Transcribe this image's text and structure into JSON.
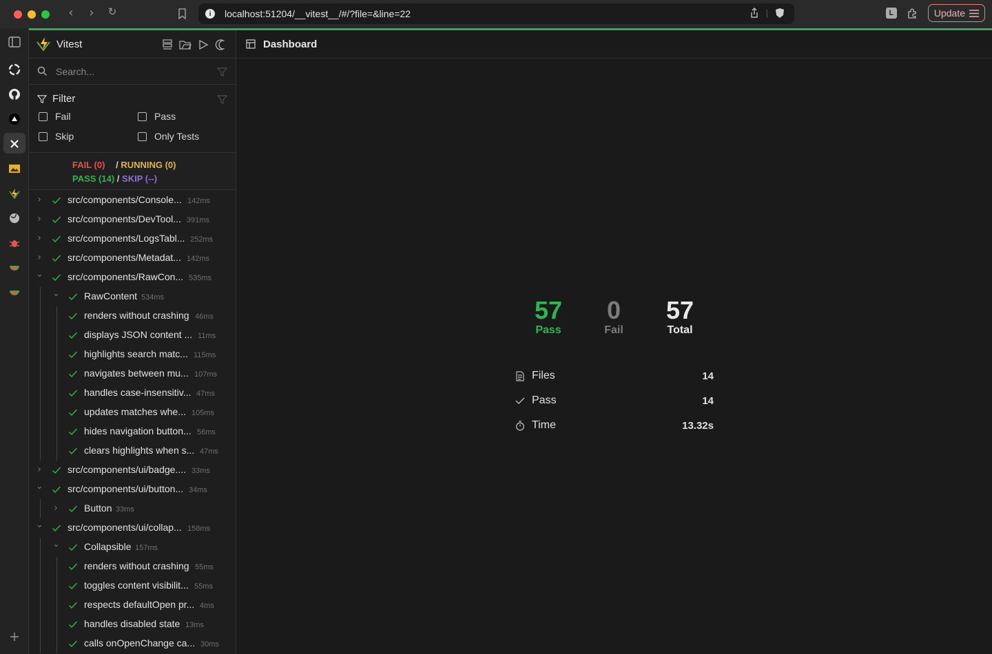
{
  "browser": {
    "url": "localhost:51204/__vitest__/#/?file=&line=22",
    "update_label": "Update",
    "ext_label": "L"
  },
  "sidebar": {
    "app_title": "Vitest",
    "search_placeholder": "Search...",
    "filter": {
      "title": "Filter",
      "options": [
        "Fail",
        "Pass",
        "Skip",
        "Only Tests"
      ]
    },
    "status": {
      "fail": "FAIL (0)",
      "sep1": "/",
      "running": "RUNNING (0)",
      "pass": "PASS (14)",
      "sep2": "/",
      "skip": "SKIP (--)"
    },
    "tree": [
      {
        "label": "src/components/Console...",
        "time": "142ms",
        "depth": 0,
        "chev": "right"
      },
      {
        "label": "src/components/DevTool...",
        "time": "391ms",
        "depth": 0,
        "chev": "right"
      },
      {
        "label": "src/components/LogsTabl...",
        "time": "252ms",
        "depth": 0,
        "chev": "right"
      },
      {
        "label": "src/components/Metadat...",
        "time": "142ms",
        "depth": 0,
        "chev": "right"
      },
      {
        "label": "src/components/RawCon...",
        "time": "535ms",
        "depth": 0,
        "chev": "down"
      },
      {
        "label": "RawContent",
        "time": "534ms",
        "depth": 1,
        "chev": "down"
      },
      {
        "label": "renders without crashing",
        "time": "46ms",
        "depth": 2,
        "chev": ""
      },
      {
        "label": "displays JSON content ...",
        "time": "11ms",
        "depth": 2,
        "chev": ""
      },
      {
        "label": "highlights search matc...",
        "time": "115ms",
        "depth": 2,
        "chev": ""
      },
      {
        "label": "navigates between mu...",
        "time": "107ms",
        "depth": 2,
        "chev": ""
      },
      {
        "label": "handles case-insensitiv...",
        "time": "47ms",
        "depth": 2,
        "chev": ""
      },
      {
        "label": "updates matches whe...",
        "time": "105ms",
        "depth": 2,
        "chev": ""
      },
      {
        "label": "hides navigation button...",
        "time": "56ms",
        "depth": 2,
        "chev": ""
      },
      {
        "label": "clears highlights when s...",
        "time": "47ms",
        "depth": 2,
        "chev": ""
      },
      {
        "label": "src/components/ui/badge....",
        "time": "33ms",
        "depth": 0,
        "chev": "right"
      },
      {
        "label": "src/components/ui/button...",
        "time": "34ms",
        "depth": 0,
        "chev": "down"
      },
      {
        "label": "Button",
        "time": "33ms",
        "depth": 1,
        "chev": "right"
      },
      {
        "label": "src/components/ui/collap...",
        "time": "158ms",
        "depth": 0,
        "chev": "down"
      },
      {
        "label": "Collapsible",
        "time": "157ms",
        "depth": 1,
        "chev": "down"
      },
      {
        "label": "renders without crashing",
        "time": "55ms",
        "depth": 2,
        "chev": ""
      },
      {
        "label": "toggles content visibilit...",
        "time": "55ms",
        "depth": 2,
        "chev": ""
      },
      {
        "label": "respects defaultOpen pr...",
        "time": "4ms",
        "depth": 2,
        "chev": ""
      },
      {
        "label": "handles disabled state",
        "time": "13ms",
        "depth": 2,
        "chev": ""
      },
      {
        "label": "calls onOpenChange ca...",
        "time": "30ms",
        "depth": 2,
        "chev": ""
      }
    ]
  },
  "main": {
    "title": "Dashboard",
    "stats": {
      "pass": {
        "value": "57",
        "label": "Pass"
      },
      "fail": {
        "value": "0",
        "label": "Fail"
      },
      "total": {
        "value": "57",
        "label": "Total"
      }
    },
    "info": [
      {
        "label": "Files",
        "value": "14",
        "icon": "file-icon"
      },
      {
        "label": "Pass",
        "value": "14",
        "icon": "check-icon"
      },
      {
        "label": "Time",
        "value": "13.32s",
        "icon": "stopwatch-icon"
      }
    ]
  },
  "colors": {
    "pass": "#2fb54f",
    "fail": "#e5534b",
    "running": "#e3b341",
    "skip": "#8b6fd6",
    "accent_line": "#2fae4f"
  }
}
